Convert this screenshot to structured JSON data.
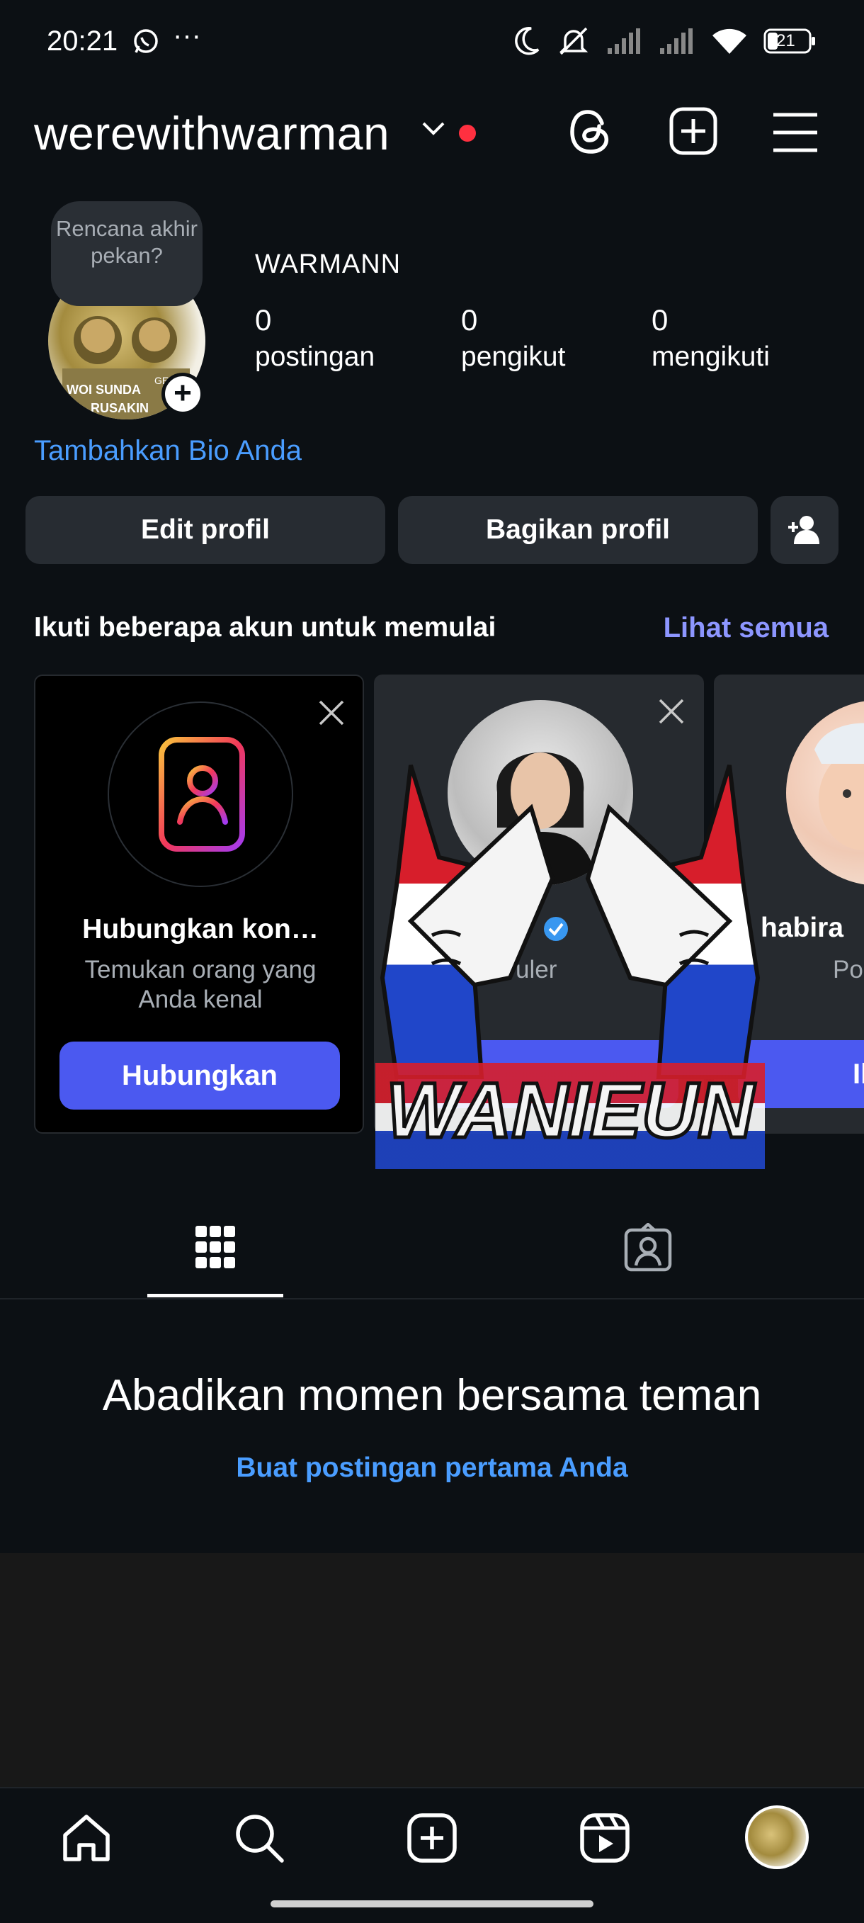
{
  "status_bar": {
    "time": "20:21",
    "more": "···",
    "battery": "21",
    "icons": [
      "whatsapp-icon",
      "moon-icon",
      "mute-icon",
      "signal-icon",
      "signal-icon",
      "wifi-icon",
      "battery-icon"
    ]
  },
  "header": {
    "username": "werewithwarman",
    "icons": [
      "threads-icon",
      "create-post-icon",
      "menu-icon"
    ]
  },
  "profile": {
    "note": "Rencana akhir pekan?",
    "display_name": "WARMANN",
    "stats": [
      {
        "value": "0",
        "label": "postingan"
      },
      {
        "value": "0",
        "label": "pengikut"
      },
      {
        "value": "0",
        "label": "mengikuti"
      }
    ],
    "add_bio": "Tambahkan Bio Anda",
    "avatar_text": [
      "WOI SUNDA",
      "GEH",
      "RUSAKIN"
    ]
  },
  "actions": {
    "edit_profile": "Edit profil",
    "share_profile": "Bagikan profil"
  },
  "suggestions": {
    "title": "Ikuti beberapa akun untuk memulai",
    "see_all": "Lihat semua",
    "cards": [
      {
        "title": "Hubungkan kon…",
        "subtitle": "Temukan orang yang Anda kenal",
        "button": "Hubungkan"
      },
      {
        "title": "",
        "subtitle": "uler",
        "button": ""
      },
      {
        "title": "habira",
        "subtitle": "Po",
        "button": "Ik"
      }
    ]
  },
  "sticker_text": "WANIEUN",
  "tabs": [
    {
      "name": "grid-icon",
      "active": true
    },
    {
      "name": "tagged-icon",
      "active": false
    }
  ],
  "empty_state": {
    "title": "Abadikan momen bersama teman",
    "link": "Buat postingan pertama Anda"
  },
  "bottom_nav": [
    "home-icon",
    "search-icon",
    "create-icon",
    "reels-icon",
    "profile-avatar"
  ],
  "colors": {
    "background": "#0c1014",
    "accent_link": "#4a9dff",
    "see_all": "#8d96ff",
    "primary_button": "#4b59f0",
    "secondary_button": "#272c32",
    "notification_dot": "#ff3040"
  }
}
